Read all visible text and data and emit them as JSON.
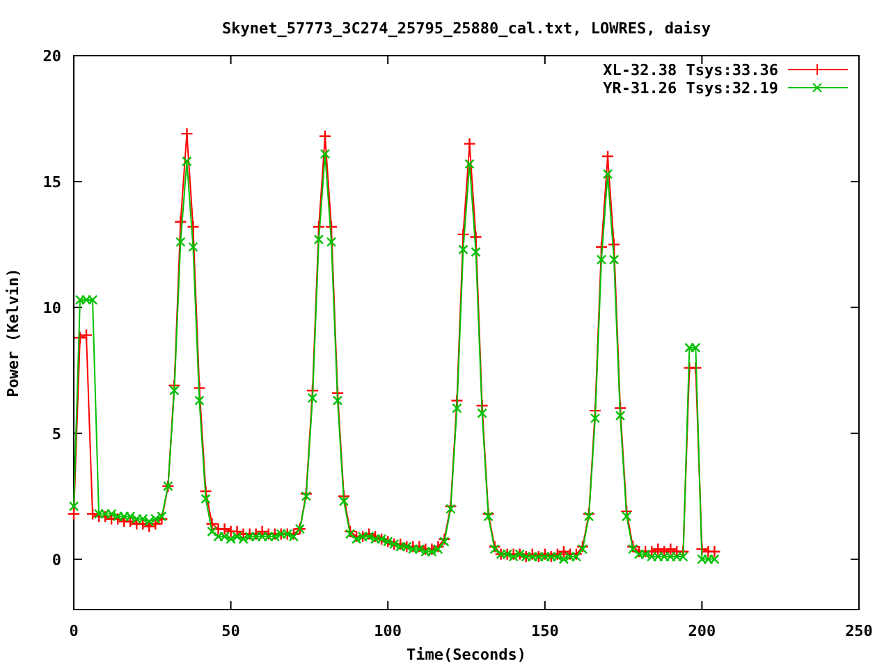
{
  "chart": {
    "chart_data": {
      "type": "line",
      "title": "Skynet_57773_3C274_25795_25880_cal.txt, LOWRES, daisy",
      "xlabel": "Time(Seconds)",
      "ylabel": "Power (Kelvin)",
      "x": [
        0,
        2,
        4,
        6,
        8,
        10,
        12,
        14,
        16,
        18,
        20,
        22,
        24,
        26,
        28,
        30,
        32,
        34,
        36,
        38,
        40,
        42,
        44,
        46,
        48,
        50,
        52,
        54,
        56,
        58,
        60,
        62,
        64,
        66,
        68,
        70,
        72,
        74,
        76,
        78,
        80,
        82,
        84,
        86,
        88,
        90,
        92,
        94,
        96,
        98,
        100,
        102,
        104,
        106,
        108,
        110,
        112,
        114,
        116,
        118,
        120,
        122,
        124,
        126,
        128,
        130,
        132,
        134,
        136,
        138,
        140,
        142,
        144,
        146,
        148,
        150,
        152,
        154,
        156,
        158,
        160,
        162,
        164,
        166,
        168,
        170,
        172,
        174,
        176,
        178,
        180,
        182,
        184,
        186,
        188,
        190,
        192,
        194,
        196,
        198,
        200,
        202,
        204
      ],
      "series": [
        {
          "name": "XL-32.38 Tsys:33.36",
          "color": "#ff0000",
          "marker": "plus",
          "values": [
            1.8,
            8.8,
            8.9,
            1.8,
            1.7,
            1.7,
            1.6,
            1.6,
            1.5,
            1.5,
            1.4,
            1.4,
            1.3,
            1.4,
            1.6,
            2.9,
            6.9,
            13.4,
            16.9,
            13.2,
            6.8,
            2.7,
            1.4,
            1.2,
            1.2,
            1.1,
            1.1,
            1.0,
            1.0,
            1.0,
            1.1,
            1.0,
            1.0,
            1.0,
            1.0,
            1.0,
            1.2,
            2.6,
            6.7,
            13.2,
            16.8,
            13.2,
            6.6,
            2.5,
            1.1,
            0.9,
            0.9,
            1.0,
            0.9,
            0.8,
            0.7,
            0.6,
            0.6,
            0.5,
            0.5,
            0.5,
            0.4,
            0.4,
            0.5,
            0.8,
            2.1,
            6.3,
            12.9,
            16.5,
            12.8,
            6.1,
            1.8,
            0.5,
            0.2,
            0.2,
            0.2,
            0.2,
            0.1,
            0.2,
            0.1,
            0.2,
            0.1,
            0.2,
            0.3,
            0.2,
            0.2,
            0.5,
            1.8,
            5.9,
            12.4,
            16.0,
            12.5,
            6.0,
            1.9,
            0.5,
            0.3,
            0.3,
            0.3,
            0.4,
            0.3,
            0.4,
            0.3,
            0.3,
            7.6,
            7.6,
            0.4,
            0.3,
            0.3
          ]
        },
        {
          "name": "YR-31.26 Tsys:32.19",
          "color": "#00c000",
          "marker": "cross",
          "values": [
            2.1,
            10.3,
            10.3,
            10.3,
            1.8,
            1.8,
            1.8,
            1.7,
            1.7,
            1.7,
            1.6,
            1.6,
            1.5,
            1.6,
            1.7,
            2.9,
            6.7,
            12.6,
            15.8,
            12.4,
            6.3,
            2.4,
            1.1,
            0.9,
            0.9,
            0.8,
            0.9,
            0.8,
            0.9,
            0.9,
            0.9,
            0.9,
            0.9,
            1.0,
            1.0,
            0.9,
            1.2,
            2.5,
            6.4,
            12.7,
            16.1,
            12.6,
            6.3,
            2.3,
            1.0,
            0.8,
            0.9,
            0.9,
            0.8,
            0.8,
            0.7,
            0.6,
            0.5,
            0.5,
            0.4,
            0.4,
            0.3,
            0.3,
            0.4,
            0.7,
            2.0,
            6.0,
            12.3,
            15.7,
            12.2,
            5.8,
            1.7,
            0.4,
            0.2,
            0.2,
            0.1,
            0.2,
            0.1,
            0.1,
            0.1,
            0.1,
            0.1,
            0.1,
            0.0,
            0.1,
            0.1,
            0.4,
            1.7,
            5.6,
            11.9,
            15.3,
            11.9,
            5.7,
            1.7,
            0.4,
            0.2,
            0.2,
            0.1,
            0.1,
            0.1,
            0.1,
            0.1,
            0.1,
            8.4,
            8.4,
            0.0,
            0.0,
            0.0
          ]
        }
      ],
      "legend": true,
      "xlim": [
        0,
        250
      ],
      "ylim": [
        -2,
        20
      ],
      "xticks": [
        0,
        50,
        100,
        150,
        200,
        250
      ],
      "yticks": [
        0,
        5,
        10,
        15,
        20
      ]
    }
  }
}
